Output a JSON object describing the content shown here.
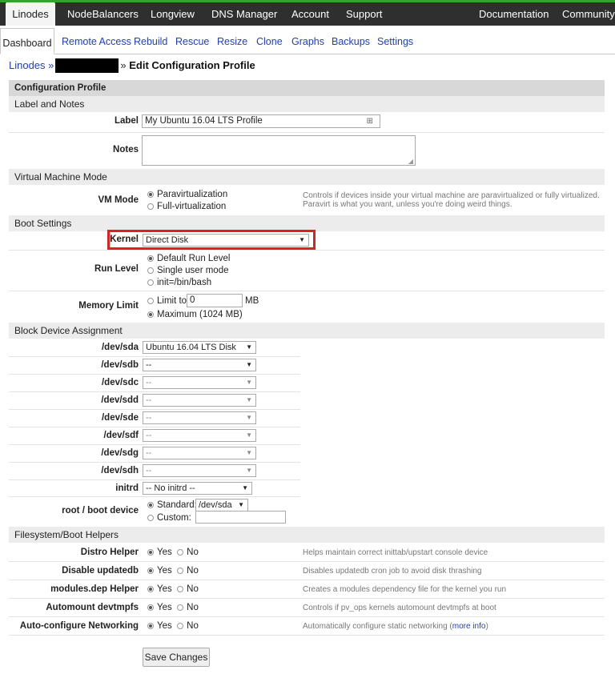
{
  "topnav": [
    {
      "label": "Linodes",
      "active": true
    },
    {
      "label": "NodeBalancers"
    },
    {
      "label": "Longview"
    },
    {
      "label": "DNS Manager"
    },
    {
      "label": "Account"
    },
    {
      "label": "Support"
    },
    {
      "label": "Documentation"
    },
    {
      "label": "Community"
    }
  ],
  "subnav": [
    {
      "label": "Dashboard",
      "active": true
    },
    {
      "label": "Remote Access"
    },
    {
      "label": "Rebuild"
    },
    {
      "label": "Rescue"
    },
    {
      "label": "Resize"
    },
    {
      "label": "Clone"
    },
    {
      "label": "Graphs"
    },
    {
      "label": "Backups"
    },
    {
      "label": "Settings"
    }
  ],
  "breadcrumb": {
    "root": "Linodes »",
    "sep": "»",
    "title": "Edit Configuration Profile"
  },
  "form": {
    "header": "Configuration Profile",
    "label_notes": {
      "section": "Label and Notes",
      "label_label": "Label",
      "label_value": "My Ubuntu 16.04 LTS Profile",
      "notes_label": "Notes"
    },
    "vm": {
      "section": "Virtual Machine Mode",
      "label": "VM Mode",
      "options": [
        "Paravirtualization",
        "Full-virtualization"
      ],
      "selected": 0,
      "help1": "Controls if devices inside your virtual machine are paravirtualized or fully virtualized.",
      "help2": "Paravirt is what you want, unless you're doing weird things."
    },
    "boot": {
      "section": "Boot Settings",
      "kernel_label": "Kernel",
      "kernel_value": "Direct Disk",
      "runlevel_label": "Run Level",
      "runlevel_options": [
        "Default Run Level",
        "Single user mode",
        "init=/bin/bash"
      ],
      "runlevel_selected": 0,
      "memory_label": "Memory Limit",
      "limit_to": "Limit to",
      "limit_value": "0",
      "limit_unit": "MB",
      "maximum": "Maximum (1024 MB)",
      "memory_selected": 1
    },
    "block": {
      "section": "Block Device Assignment",
      "devices": [
        {
          "label": "/dev/sda",
          "value": "Ubuntu 16.04 LTS Disk"
        },
        {
          "label": "/dev/sdb",
          "value": "--"
        },
        {
          "label": "/dev/sdc",
          "value": "--"
        },
        {
          "label": "/dev/sdd",
          "value": "--"
        },
        {
          "label": "/dev/sde",
          "value": "--"
        },
        {
          "label": "/dev/sdf",
          "value": "--"
        },
        {
          "label": "/dev/sdg",
          "value": "--"
        },
        {
          "label": "/dev/sdh",
          "value": "--"
        }
      ],
      "initrd_label": "initrd",
      "initrd_value": "-- No initrd --",
      "root_label": "root / boot device",
      "standard": "Standard:",
      "standard_value": "/dev/sda",
      "custom": "Custom:"
    },
    "helpers": {
      "section": "Filesystem/Boot Helpers",
      "yes": "Yes",
      "no": "No",
      "items": [
        {
          "label": "Distro Helper",
          "help": "Helps maintain correct inittab/upstart console device"
        },
        {
          "label": "Disable updatedb",
          "help": "Disables updatedb cron job to avoid disk thrashing"
        },
        {
          "label": "modules.dep Helper",
          "help": "Creates a modules dependency file for the kernel you run"
        },
        {
          "label": "Automount devtmpfs",
          "help": "Controls if pv_ops kernels automount devtmpfs at boot"
        },
        {
          "label": "Auto-configure Networking",
          "help": "Automatically configure static networking",
          "link": "more info"
        }
      ]
    },
    "save_label": "Save Changes"
  },
  "icons": {
    "select_arrow": "▼",
    "input_badge": "⊞"
  }
}
